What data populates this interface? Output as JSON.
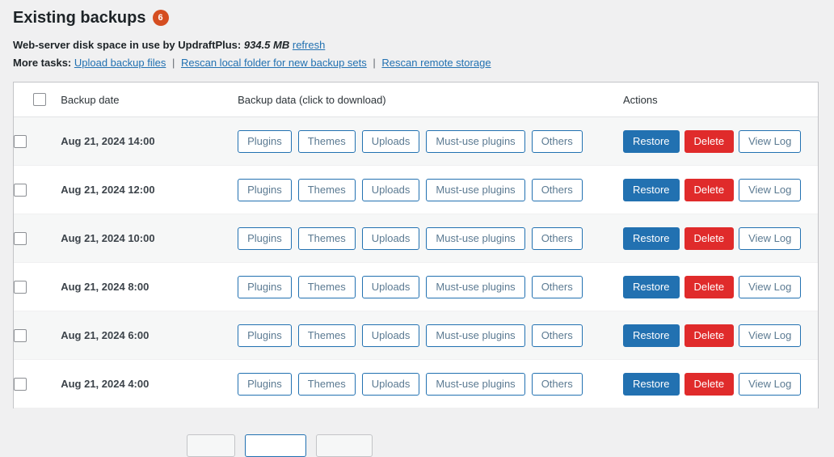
{
  "header": {
    "title": "Existing backups",
    "count_badge": "6",
    "disk_usage_label": "Web-server disk space in use by UpdraftPlus:",
    "disk_usage_value": "934.5 MB",
    "refresh_link": "refresh",
    "more_tasks_label": "More tasks:",
    "separator": "|",
    "tasks": [
      "Upload backup files",
      "Rescan local folder for new backup sets",
      "Rescan remote storage"
    ]
  },
  "table": {
    "columns": {
      "select": "",
      "date": "Backup date",
      "data": "Backup data (click to download)",
      "actions": "Actions"
    },
    "data_buttons": [
      "Plugins",
      "Themes",
      "Uploads",
      "Must-use plugins",
      "Others"
    ],
    "action_buttons": {
      "restore": "Restore",
      "delete": "Delete",
      "view_log": "View Log"
    },
    "rows": [
      {
        "date": "Aug 21, 2024 14:00"
      },
      {
        "date": "Aug 21, 2024 12:00"
      },
      {
        "date": "Aug 21, 2024 10:00"
      },
      {
        "date": "Aug 21, 2024 8:00"
      },
      {
        "date": "Aug 21, 2024 6:00"
      },
      {
        "date": "Aug 21, 2024 4:00"
      }
    ]
  },
  "pagination": {
    "buttons": [
      "",
      "",
      ""
    ],
    "active_index": 1
  },
  "colors": {
    "accent_blue": "#2271b1",
    "danger_red": "#e02b2b",
    "badge_orange": "#d54e21",
    "page_bg": "#f0f0f1",
    "row_alt_bg": "#f6f7f7"
  }
}
